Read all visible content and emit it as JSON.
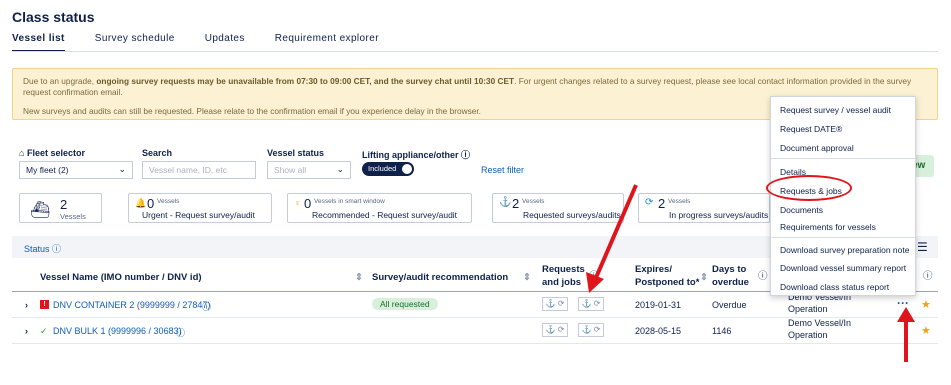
{
  "page": {
    "title": "Class status"
  },
  "tabs": [
    {
      "label": "Vessel list",
      "active": true
    },
    {
      "label": "Survey schedule",
      "active": false
    },
    {
      "label": "Updates",
      "active": false
    },
    {
      "label": "Requirement explorer",
      "active": false
    }
  ],
  "banner": {
    "line1_pre": "Due to an upgrade, ",
    "line1_bold": "ongoing survey requests may be unavailable from 07:30 to 09:00 CET, and the survey chat until 10:30 CET",
    "line1_post": ". For urgent changes related to a survey request, please see local contact information provided in the survey request confirmation email.",
    "line2": "New surveys and audits can still be requested. Please relate to the confirmation email if you experience delay in the browser."
  },
  "filters": {
    "fleet_label": "Fleet selector",
    "fleet_value": "My fleet (2)",
    "search_label": "Search",
    "search_placeholder": "Vessel name, ID, etc",
    "status_label": "Vessel status",
    "status_value": "Show all",
    "lifting_label": "Lifting appliance/other",
    "lifting_toggle": "Included",
    "reset_label": "Reset filter"
  },
  "summary_cards": {
    "vessels_count": "2",
    "vessels_label": "Vessels",
    "urgent_count": "0",
    "urgent_small": "Vessels",
    "urgent_desc": "Urgent - Request survey/audit",
    "recommended_count": "0",
    "recommended_small": "Vessels in smart window",
    "recommended_desc": "Recommended - Request survey/audit",
    "requested_count": "2",
    "requested_small": "Vessels",
    "requested_desc": "Requested surveys/audits",
    "inprogress_count": "2",
    "inprogress_small": "Vessels",
    "inprogress_desc": "In progress surveys/audits",
    "new_badge": "ew"
  },
  "status_bar": {
    "label": "Status"
  },
  "table": {
    "columns": {
      "name": "Vessel Name (IMO number / DNV id)",
      "recommendation": "Survey/audit recommendation",
      "requests_line1": "Requests",
      "requests_line2": "and jobs",
      "expires_line1": "Expires/",
      "expires_line2": "Postponed to*",
      "days_line1": "Days to",
      "days_line2": "overdue"
    },
    "rows": [
      {
        "name": "DNV CONTAINER 2 (9999999 / 27847)",
        "recommendation": "All requested",
        "expires": "2019-01-31",
        "days": "Overdue",
        "class_status_line1": "Demo Vessel/In",
        "class_status_line2": "Operation"
      },
      {
        "name": "DNV BULK 1 (9999996 / 30683)",
        "recommendation": "",
        "expires": "2028-05-15",
        "days": "1146",
        "class_status_line1": "Demo Vessel/In",
        "class_status_line2": "Operation"
      }
    ]
  },
  "context_menu": {
    "items": [
      "Request survey / vessel audit",
      "Request DATE®",
      "Document approval",
      "Details",
      "Requests & jobs",
      "Documents",
      "Requirements for vessels",
      "Download survey preparation note",
      "Download vessel summary report",
      "Download class status report"
    ]
  },
  "colors": {
    "accent": "#0f204b",
    "link": "#0f5cb8",
    "annotation": "#e0151b",
    "banner_bg": "#fdf1d3"
  }
}
